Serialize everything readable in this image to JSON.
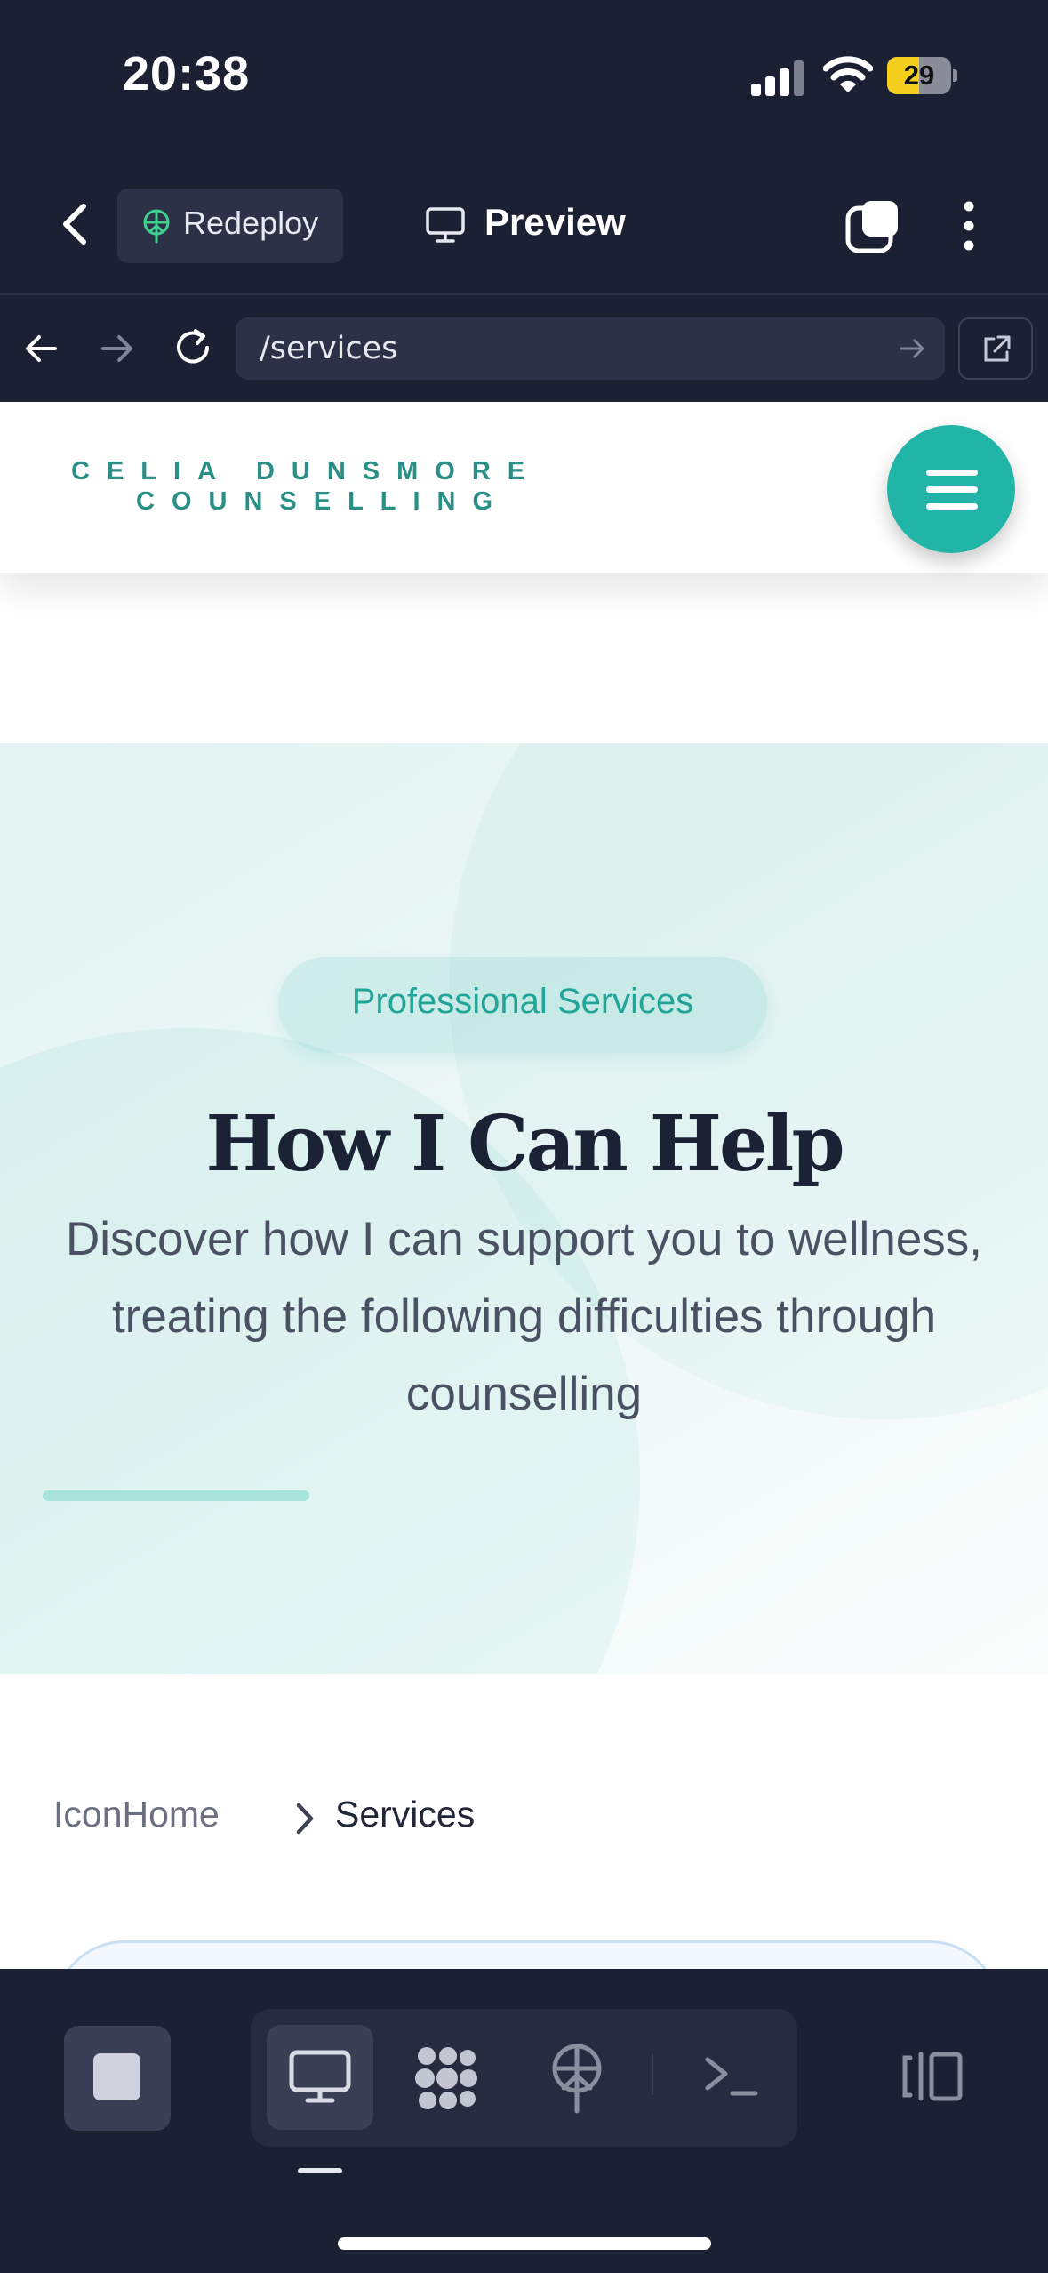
{
  "status_bar": {
    "time": "20:38",
    "battery": "29"
  },
  "toolbar": {
    "redeploy_label": "Redeploy",
    "preview_label": "Preview"
  },
  "browser": {
    "url": "/services"
  },
  "site": {
    "logo_line1": "CELIA DUNSMORE",
    "logo_line2": "COUNSELLING"
  },
  "hero": {
    "badge": "Professional Services",
    "title": "How I Can Help",
    "subtitle": "Discover how I can support you to wellness, treating the following difficulties through counselling"
  },
  "breadcrumb": {
    "home": "IconHome",
    "current": "Services"
  },
  "colors": {
    "accent": "#20b5a6",
    "dark": "#1c2033",
    "logo": "#2a8f86"
  }
}
